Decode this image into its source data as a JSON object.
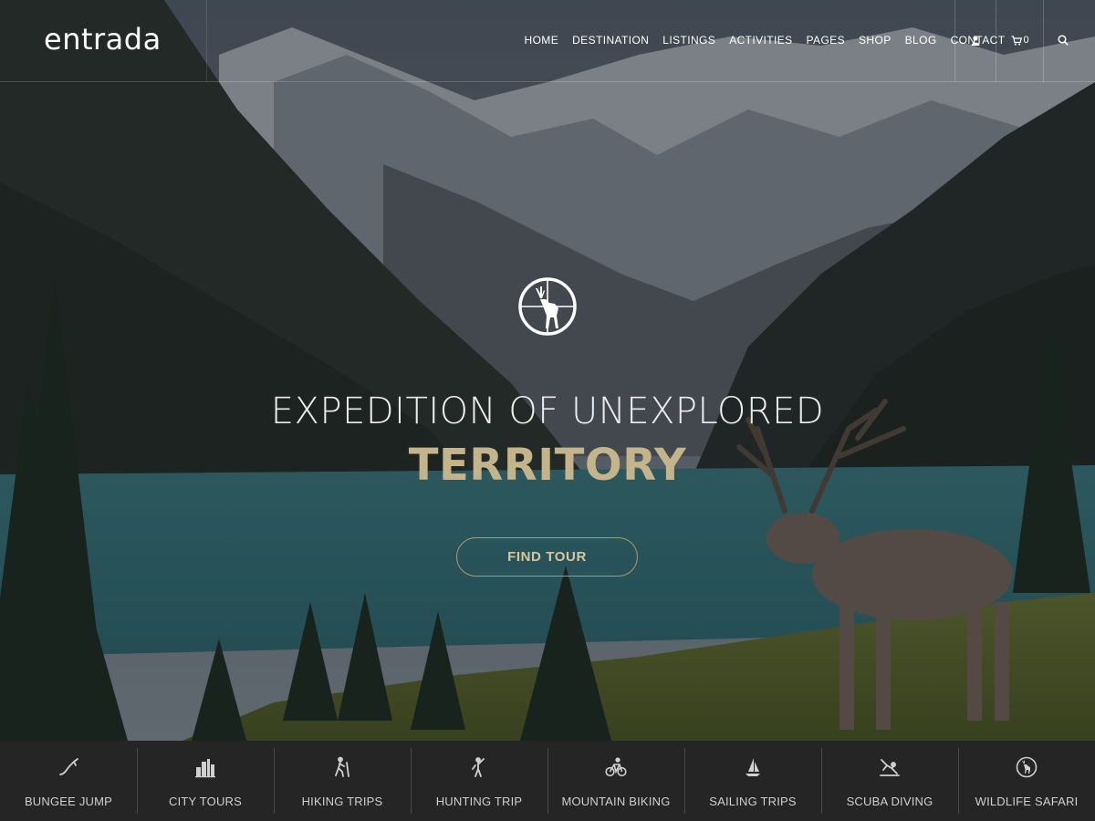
{
  "brand": {
    "logo_text": "entrada"
  },
  "nav": {
    "items": [
      "HOME",
      "DESTINATION",
      "LISTINGS",
      "ACTIVITIES",
      "PAGES",
      "SHOP",
      "BLOG",
      "CONTACT"
    ],
    "cart_count": "0"
  },
  "hero": {
    "headline_line1": "EXPEDITION OF UNEXPLORED",
    "headline_line2": "TERRITORY",
    "cta_label": "FIND TOUR"
  },
  "activities": [
    {
      "label": "BUNGEE JUMP",
      "icon": "bungee-jump-icon"
    },
    {
      "label": "CITY TOURS",
      "icon": "city-tours-icon"
    },
    {
      "label": "HIKING TRIPS",
      "icon": "hiking-icon"
    },
    {
      "label": "HUNTING TRIP",
      "icon": "hunting-icon"
    },
    {
      "label": "MOUNTAIN BIKING",
      "icon": "mountain-biking-icon"
    },
    {
      "label": "SAILING TRIPS",
      "icon": "sailing-icon"
    },
    {
      "label": "SCUBA DIVING",
      "icon": "scuba-diving-icon"
    },
    {
      "label": "WILDLIFE SAFARI",
      "icon": "wildlife-safari-icon"
    }
  ],
  "colors": {
    "accent_gold": "#c4b48c",
    "activities_bar_bg": "#252525",
    "lake": "#3f8a8f"
  }
}
